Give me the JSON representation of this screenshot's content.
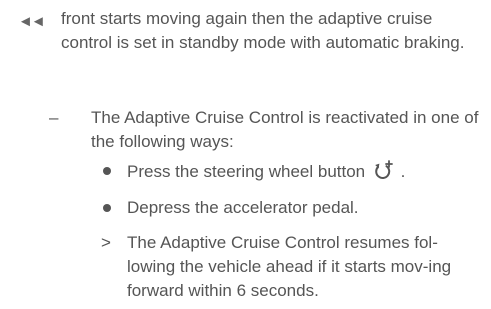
{
  "continuation_marker": "◄◄",
  "intro_text": "front starts moving again then the adaptive cruise control is set in standby mode with automatic braking.",
  "step": {
    "marker": "–",
    "text": "The Adaptive Cruise Control is reactivated in one of the following ways:"
  },
  "bullets": [
    {
      "text_before_icon": "Press the steering wheel button",
      "icon": "resume-cruise-icon",
      "text_after_icon": "."
    },
    {
      "text": "Depress the accelerator pedal."
    }
  ],
  "result": {
    "marker": ">",
    "text": "The Adaptive Cruise Control resumes fol-lowing the vehicle ahead if it starts mov-ing forward within 6 seconds."
  }
}
